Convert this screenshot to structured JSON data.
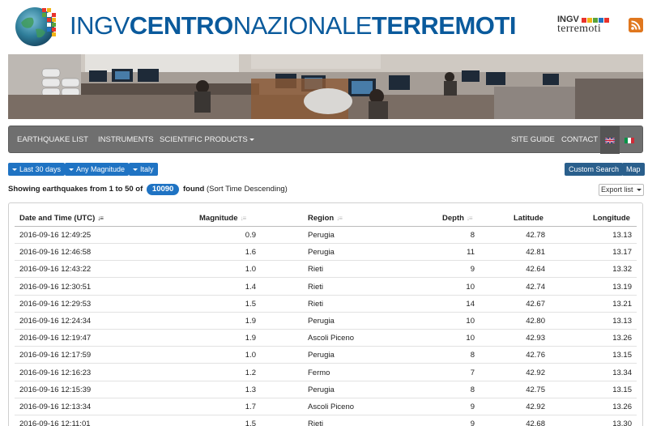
{
  "header": {
    "title_part1": "INGV",
    "title_part2": "CENTRO",
    "title_part3": "NAZIONALE",
    "title_part4": "TERREMOTI",
    "brand_top": "INGV",
    "brand_bottom": "terremoti",
    "logo_icon": "ingv-globe-logo",
    "rss_icon": "rss-icon"
  },
  "nav": {
    "earthquake_list": "EARTHQUAKE LIST",
    "instruments": "INSTRUMENTS",
    "scientific_products": "SCIENTIFIC PRODUCTS",
    "site_guide": "SITE GUIDE",
    "contact": "CONTACT"
  },
  "filters": {
    "period": "Last 30 days",
    "magnitude": "Any Magnitude",
    "area": "Italy",
    "custom_search": "Custom Search",
    "map": "Map"
  },
  "summary": {
    "prefix": "Showing earthquakes from 1 to 50 of",
    "count": "10090",
    "suffix": "found",
    "sort": "(Sort Time Descending)",
    "export": "Export list"
  },
  "table": {
    "columns": {
      "date": "Date and Time (UTC)",
      "magnitude": "Magnitude",
      "region": "Region",
      "depth": "Depth",
      "latitude": "Latitude",
      "longitude": "Longitude"
    },
    "rows": [
      {
        "date": "2016-09-16 12:49:25",
        "mag": "0.9",
        "region": "Perugia",
        "depth": "8",
        "lat": "42.78",
        "lon": "13.13"
      },
      {
        "date": "2016-09-16 12:46:58",
        "mag": "1.6",
        "region": "Perugia",
        "depth": "11",
        "lat": "42.81",
        "lon": "13.17"
      },
      {
        "date": "2016-09-16 12:43:22",
        "mag": "1.0",
        "region": "Rieti",
        "depth": "9",
        "lat": "42.64",
        "lon": "13.32"
      },
      {
        "date": "2016-09-16 12:30:51",
        "mag": "1.4",
        "region": "Rieti",
        "depth": "10",
        "lat": "42.74",
        "lon": "13.19"
      },
      {
        "date": "2016-09-16 12:29:53",
        "mag": "1.5",
        "region": "Rieti",
        "depth": "14",
        "lat": "42.67",
        "lon": "13.21"
      },
      {
        "date": "2016-09-16 12:24:34",
        "mag": "1.9",
        "region": "Perugia",
        "depth": "10",
        "lat": "42.80",
        "lon": "13.13"
      },
      {
        "date": "2016-09-16 12:19:47",
        "mag": "1.9",
        "region": "Ascoli Piceno",
        "depth": "10",
        "lat": "42.93",
        "lon": "13.26"
      },
      {
        "date": "2016-09-16 12:17:59",
        "mag": "1.0",
        "region": "Perugia",
        "depth": "8",
        "lat": "42.76",
        "lon": "13.15"
      },
      {
        "date": "2016-09-16 12:16:23",
        "mag": "1.2",
        "region": "Fermo",
        "depth": "7",
        "lat": "42.92",
        "lon": "13.34"
      },
      {
        "date": "2016-09-16 12:15:39",
        "mag": "1.3",
        "region": "Perugia",
        "depth": "8",
        "lat": "42.75",
        "lon": "13.15"
      },
      {
        "date": "2016-09-16 12:13:34",
        "mag": "1.7",
        "region": "Ascoli Piceno",
        "depth": "9",
        "lat": "42.92",
        "lon": "13.26"
      },
      {
        "date": "2016-09-16 12:11:01",
        "mag": "1.5",
        "region": "Rieti",
        "depth": "9",
        "lat": "42.68",
        "lon": "13.30"
      }
    ]
  },
  "colors": {
    "brand_blue": "#0a5a9c",
    "button_blue": "#1f73c3",
    "button_dark": "#2a5f8c",
    "navbar": "#6f6f6f",
    "rss": "#e0771e"
  }
}
